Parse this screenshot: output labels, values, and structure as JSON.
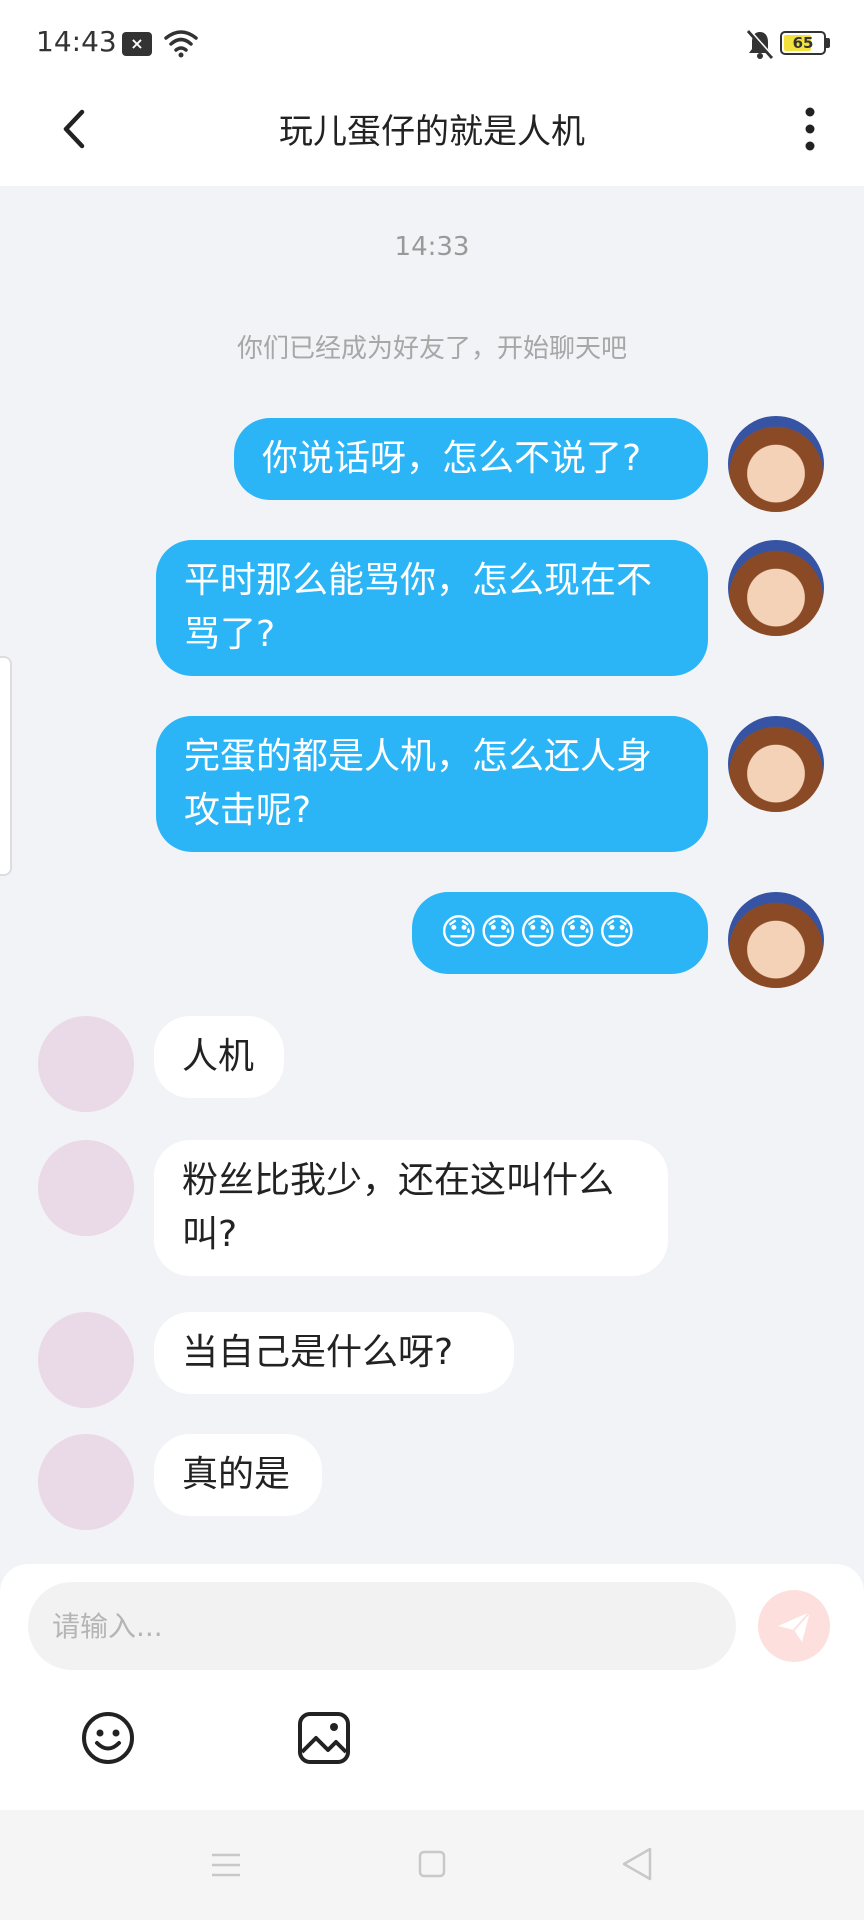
{
  "status_bar": {
    "time": "14:43",
    "notification_icon": "close-badge-icon",
    "battery": "65"
  },
  "header": {
    "title": "玩儿蛋仔的就是人机",
    "back_icon": "back-chevron-icon",
    "more_icon": "more-vertical-icon"
  },
  "chat": {
    "timestamp": "14:33",
    "system_message": "你们已经成为好友了，开始聊天吧",
    "messages": [
      {
        "from": "me",
        "text": "你说话呀，怎么不说了?"
      },
      {
        "from": "me",
        "text": "平时那么能骂你，怎么现在不骂了?"
      },
      {
        "from": "me",
        "text": "完蛋的都是人机，怎么还人身攻击呢?"
      },
      {
        "from": "me",
        "text": "😓😓😓😓😓"
      },
      {
        "from": "other",
        "text": "人机"
      },
      {
        "from": "other",
        "text": "粉丝比我少，还在这叫什么叫?"
      },
      {
        "from": "other",
        "text": "当自己是什么呀?"
      },
      {
        "from": "other",
        "text": "真的是"
      }
    ]
  },
  "input": {
    "placeholder": "请输入...",
    "send_icon": "send-icon",
    "emoji_icon": "emoji-icon",
    "image_icon": "image-icon"
  },
  "colors": {
    "my_bubble": "#2bb5f7",
    "other_bubble": "#ffffff",
    "background": "#f2f3f7"
  }
}
